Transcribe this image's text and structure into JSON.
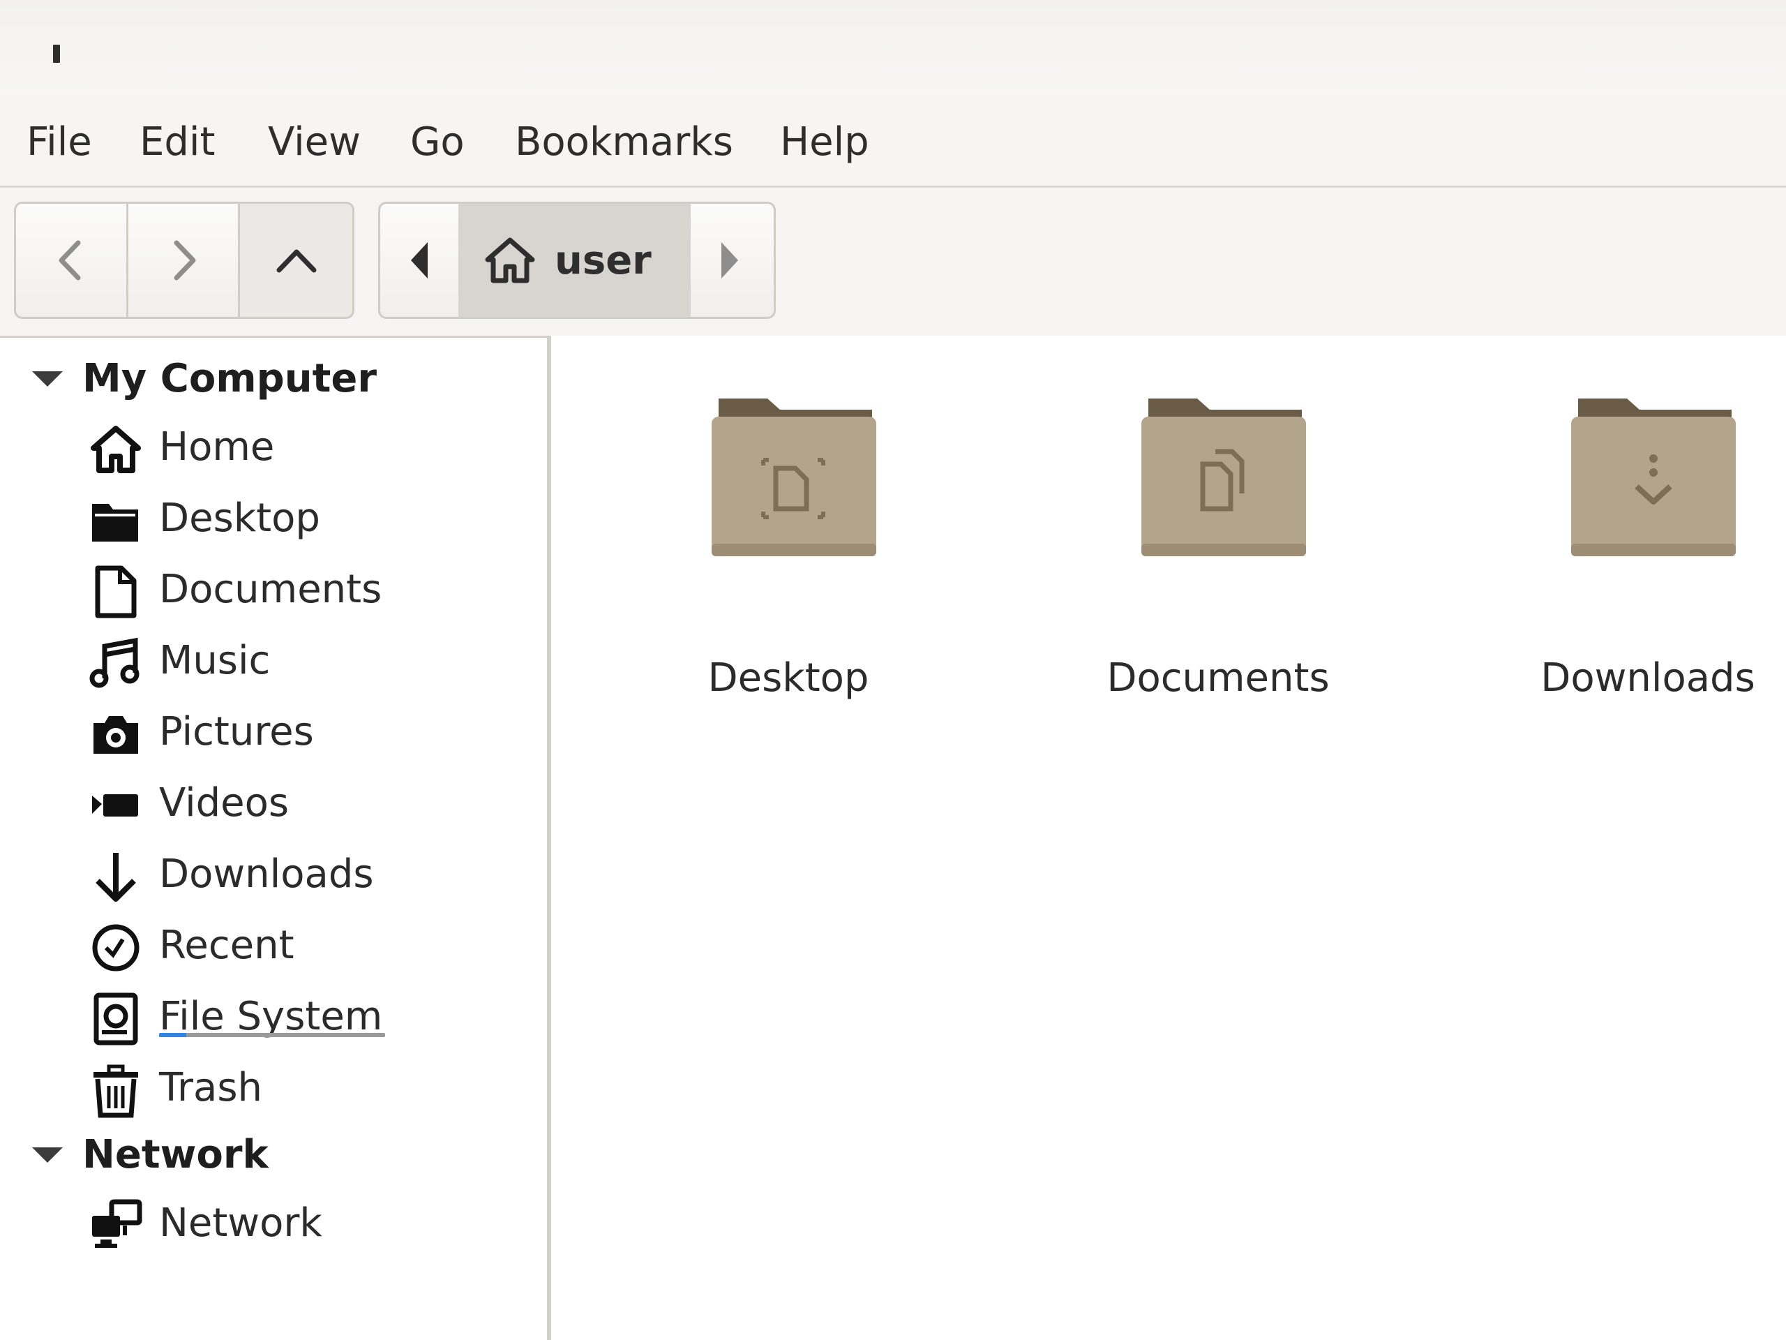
{
  "window": {
    "title": ""
  },
  "menubar": {
    "items": [
      "File",
      "Edit",
      "View",
      "Go",
      "Bookmarks",
      "Help"
    ]
  },
  "toolbar": {
    "back_icon": "chevron-left-icon",
    "forward_icon": "chevron-right-icon",
    "up_icon": "chevron-up-icon",
    "path_crumb_label": "user",
    "path_crumb_icon": "home-icon"
  },
  "sidebar": {
    "sections": [
      {
        "label": "My Computer",
        "items": [
          {
            "label": "Home",
            "icon": "home-icon"
          },
          {
            "label": "Desktop",
            "icon": "folder-icon"
          },
          {
            "label": "Documents",
            "icon": "document-icon"
          },
          {
            "label": "Music",
            "icon": "music-icon"
          },
          {
            "label": "Pictures",
            "icon": "camera-icon"
          },
          {
            "label": "Videos",
            "icon": "video-camera-icon"
          },
          {
            "label": "Downloads",
            "icon": "download-arrow-icon"
          },
          {
            "label": "Recent",
            "icon": "clock-icon"
          },
          {
            "label": "File System",
            "icon": "drive-icon"
          },
          {
            "label": "Trash",
            "icon": "trash-icon"
          }
        ]
      },
      {
        "label": "Network",
        "items": [
          {
            "label": "Network",
            "icon": "network-icon"
          }
        ]
      }
    ],
    "filesystem_usage_fraction": 0.12,
    "usage_color": "#3584e4"
  },
  "main": {
    "files": [
      {
        "label": "Desktop",
        "icon": "desktop-folder-icon"
      },
      {
        "label": "Documents",
        "icon": "documents-folder-icon"
      },
      {
        "label": "Downloads",
        "icon": "downloads-folder-icon"
      }
    ],
    "folder_color": "#b3a48c"
  }
}
